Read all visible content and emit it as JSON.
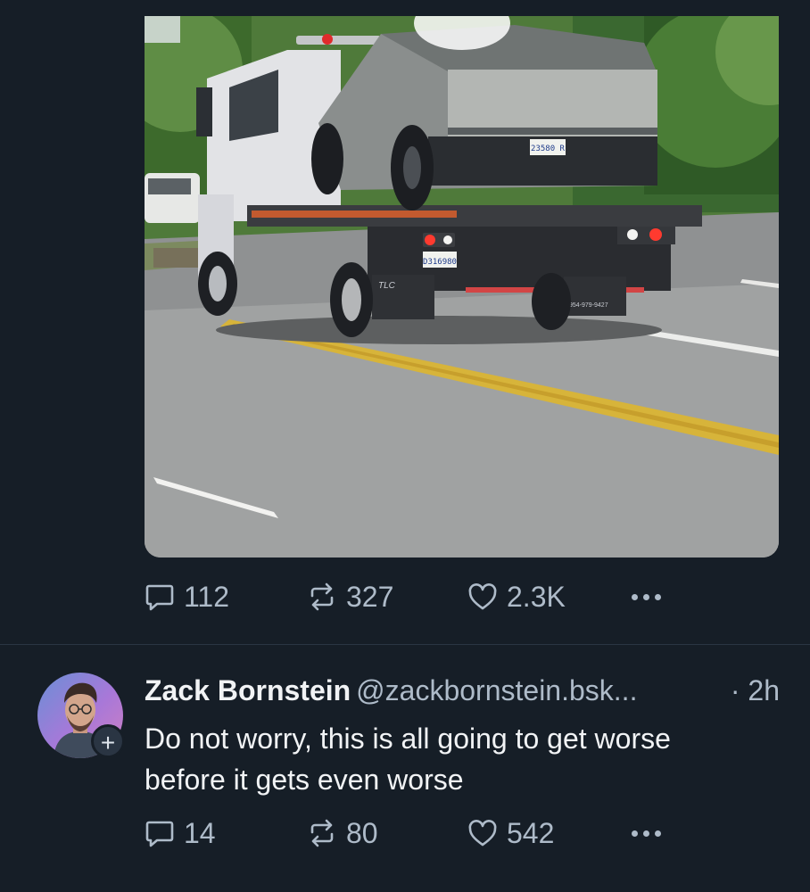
{
  "post": {
    "stats": {
      "replies": "112",
      "reposts": "327",
      "likes": "2.3K"
    },
    "plates": {
      "car": "23580 R",
      "truck": "D316980",
      "phone": "954-979-9427",
      "truck_logo": "TLC"
    }
  },
  "reply": {
    "display_name": "Zack Bornstein",
    "handle": "@zackbornstein.bsk...",
    "timestamp": "· 2h",
    "text_lines": [
      "Do not worry, this is all going to get worse",
      "before it gets even worse"
    ],
    "follow_symbol": "+",
    "stats": {
      "replies": "14",
      "reposts": "80",
      "likes": "542"
    }
  },
  "icons": {
    "reply": "speech-bubble-icon",
    "repost": "repost-arrows-icon",
    "like": "heart-outline-icon",
    "more": "ellipsis-icon"
  },
  "colors": {
    "background": "#161e27",
    "muted_text": "#aebbc9",
    "primary_text": "#f1f3f5",
    "divider": "#2a3543"
  }
}
